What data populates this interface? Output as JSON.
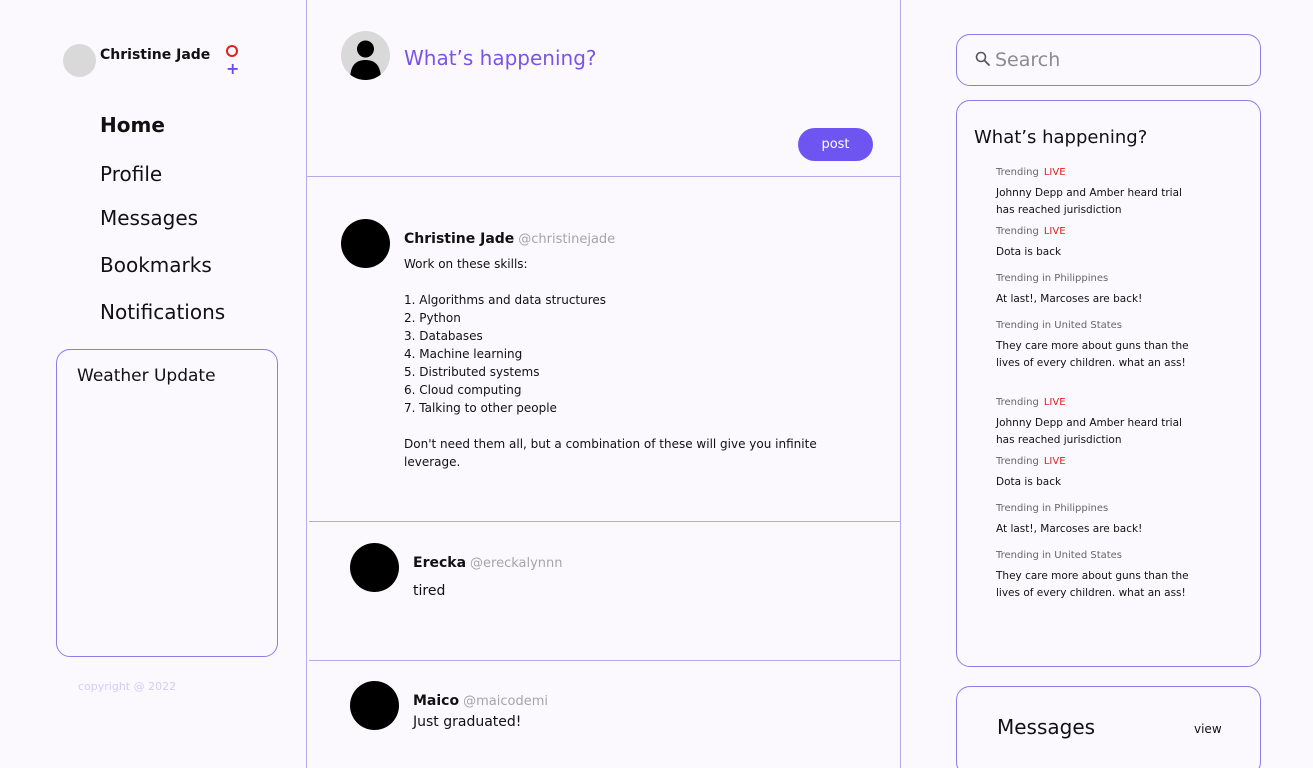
{
  "user": {
    "name": "Christine Jade"
  },
  "nav": {
    "home": "Home",
    "profile": "Profile",
    "messages": "Messages",
    "bookmarks": "Bookmarks",
    "notifications": "Notifications"
  },
  "weather": {
    "title": "Weather Update"
  },
  "footer": {
    "copyright": "copyright @ 2022"
  },
  "compose": {
    "placeholder": "What’s happening?",
    "post_label": "post"
  },
  "tweets": [
    {
      "name": "Christine Jade",
      "handle": "@christinejade",
      "body": "Work on these skills:\n\n1. Algorithms and data structures\n2. Python\n3. Databases\n4. Machine learning\n5. Distributed systems\n6. Cloud computing\n7. Talking to other people\n\nDon't need them all, but a combination of these will give you infinite leverage."
    },
    {
      "name": "Erecka",
      "handle": "@ereckalynnn",
      "body": "tired"
    },
    {
      "name": "Maico",
      "handle": "@maicodemi",
      "body": "Just graduated!"
    }
  ],
  "search": {
    "placeholder": "Search"
  },
  "trends": {
    "title": "What’s happening?",
    "items": [
      {
        "category": "Trending",
        "live": "LIVE",
        "text": "Johnny Depp and Amber heard trial has reached jurisdiction"
      },
      {
        "category": "Trending",
        "live": "LIVE",
        "text": "Dota is back"
      },
      {
        "category": "Trending in Philippines",
        "live": "",
        "text": "At last!, Marcoses are back!"
      },
      {
        "category": "Trending in United States",
        "live": "",
        "text": "They care more about guns than the lives of every children. what an ass!"
      },
      {
        "category": "Trending",
        "live": "LIVE",
        "text": "Johnny Depp and Amber heard trial has reached jurisdiction"
      },
      {
        "category": "Trending",
        "live": "LIVE",
        "text": "Dota is back"
      },
      {
        "category": "Trending in Philippines",
        "live": "",
        "text": "At last!, Marcoses are back!"
      },
      {
        "category": "Trending in United States",
        "live": "",
        "text": "They care more about guns than the lives of every children. what an ass!"
      }
    ]
  },
  "messages": {
    "title": "Messages",
    "view_label": "view"
  },
  "colors": {
    "accent": "#6e55f2",
    "border": "#8a7ee6",
    "live": "#e02020",
    "background": "#fbf9fe"
  }
}
